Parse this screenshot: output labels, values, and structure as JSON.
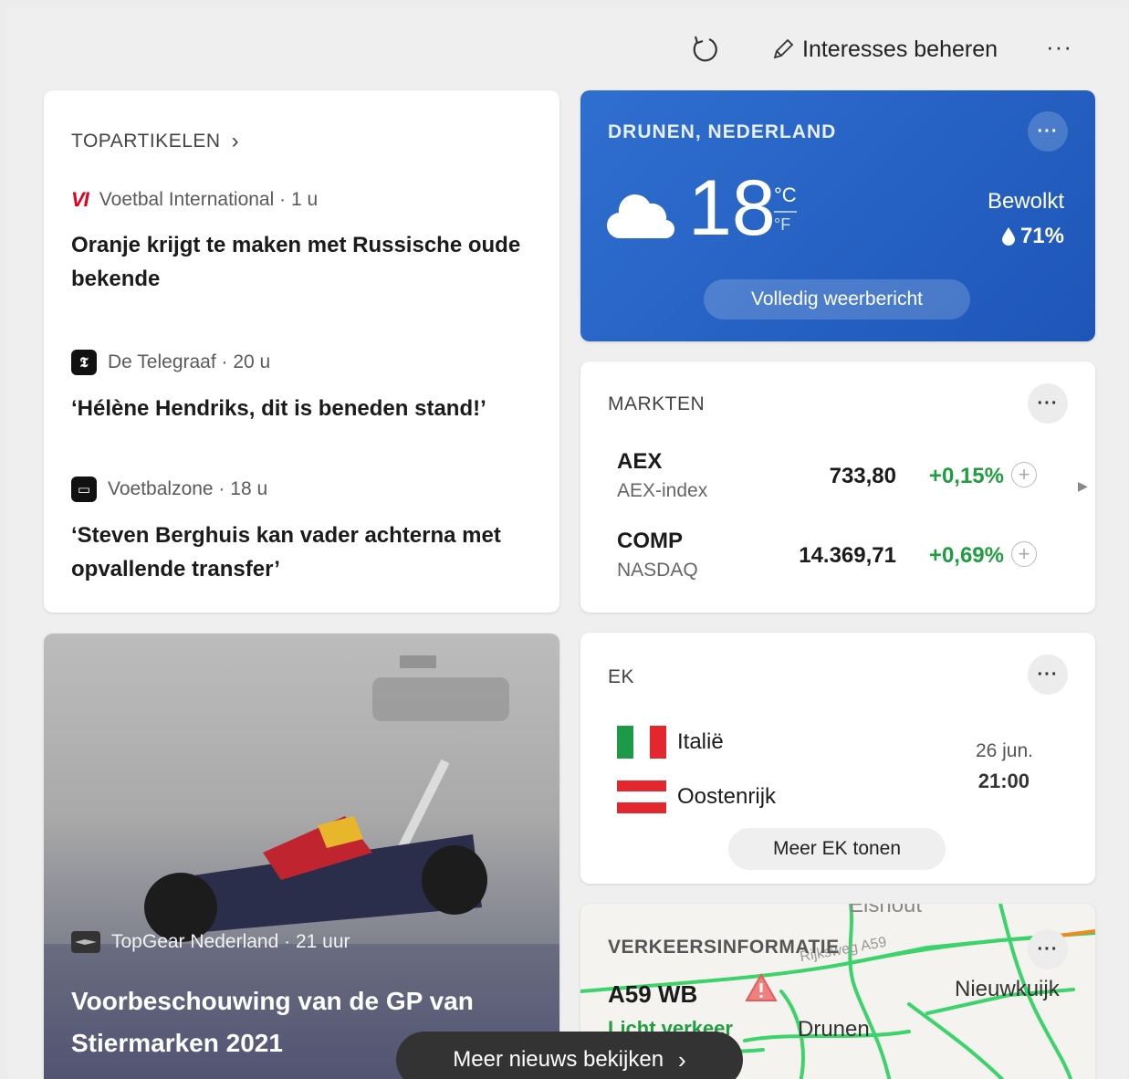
{
  "toolbar": {
    "refresh_icon": "refresh-icon",
    "manage_label": "Interesses beheren",
    "more_label": "···"
  },
  "top_articles": {
    "title": "TOPARTIKELEN",
    "chevron": "›",
    "items": [
      {
        "source": "Voetbal International · 1 u",
        "logo": "VI",
        "headline": "Oranje krijgt te maken met Russische oude bekende"
      },
      {
        "source": "De Telegraaf · 20 u",
        "logo": "𝕿",
        "headline": "‘Hélène Hendriks, dit is beneden stand!’"
      },
      {
        "source": "Voetbalzone · 18 u",
        "logo": "▭",
        "headline": "‘Steven Berghuis kan vader achterna met opvallende transfer’"
      }
    ]
  },
  "weather": {
    "location": "DRUNEN, NEDERLAND",
    "temperature": "18",
    "unit_c": "°C",
    "unit_f": "°F",
    "condition": "Bewolkt",
    "humidity": "71%",
    "button": "Volledig weerbericht",
    "dots": "···",
    "colors": {
      "bg": "#2563c4"
    }
  },
  "markets": {
    "title": "MARKTEN",
    "dots": "···",
    "rows": [
      {
        "symbol": "AEX",
        "name": "AEX-index",
        "price": "733,80",
        "change": "+0,15%"
      },
      {
        "symbol": "COMP",
        "name": "NASDAQ",
        "price": "14.369,71",
        "change": "+0,69%"
      }
    ],
    "colors": {
      "positive": "#1e9e3e"
    }
  },
  "ek": {
    "title": "EK",
    "dots": "···",
    "team1": "Italië",
    "team2": "Oostenrijk",
    "date": "26 jun.",
    "time": "21:00",
    "button": "Meer EK tonen"
  },
  "traffic": {
    "title": "VERKEERSINFORMATIE",
    "road": "A59 WB",
    "status": "Licht verkeer",
    "places": [
      "Elshout",
      "Nieuwkuijk",
      "Drunen",
      "Rijksweg A59"
    ],
    "dots": "···"
  },
  "news_card": {
    "source": "TopGear Nederland · 21 uur",
    "headline": "Voorbeschouwing van de GP van Stiermarken 2021"
  },
  "more_news": {
    "label": "Meer nieuws bekijken",
    "chevron": "›"
  }
}
